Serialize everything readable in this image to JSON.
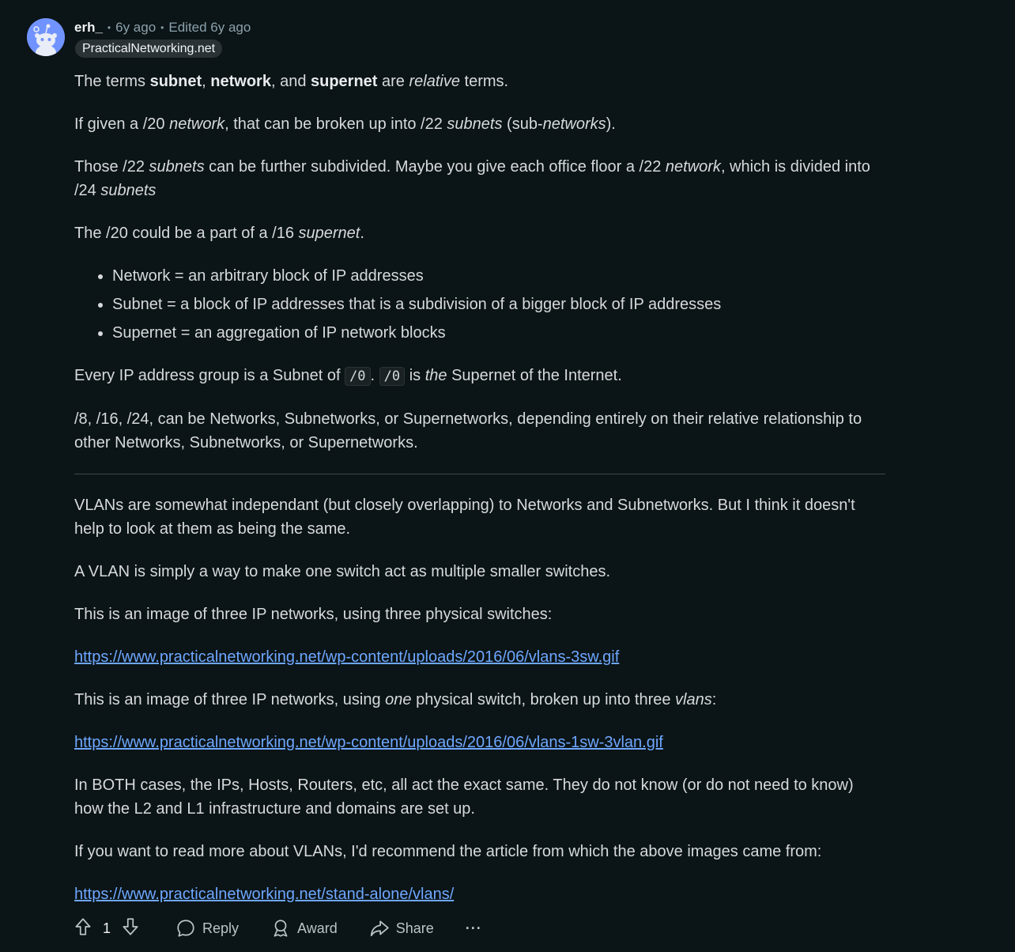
{
  "comment": {
    "author": "erh_",
    "age": "6y ago",
    "edited": "Edited 6y ago",
    "flair": "PracticalNetworking.net"
  },
  "body": {
    "p1": {
      "a": "The terms ",
      "b": "subnet",
      "c": ", ",
      "d": "network",
      "e": ", and ",
      "f": "supernet",
      "g": " are ",
      "h": "relative",
      "i": " terms."
    },
    "p2": {
      "a": "If given a /20 ",
      "b": "network",
      "c": ", that can be broken up into /22 ",
      "d": "subnets",
      "e": " (sub-",
      "f": "networks",
      "g": ")."
    },
    "p3": {
      "a": "Those /22 ",
      "b": "subnets",
      "c": " can be further subdivided. Maybe you give each office floor a /22 ",
      "d": "network",
      "e": ", which is divided into /24 ",
      "f": "subnets"
    },
    "p4": {
      "a": "The /20 could be a part of a /16 ",
      "b": "supernet",
      "c": "."
    },
    "bullets": [
      "Network = an arbitrary block of IP addresses",
      "Subnet = a block of IP addresses that is a subdivision of a bigger block of IP addresses",
      "Supernet = an aggregation of IP network blocks"
    ],
    "p5": {
      "a": "Every IP address group is a Subnet of ",
      "code1": "/0",
      "b": ". ",
      "code2": "/0",
      "c": " is ",
      "d": "the",
      "e": " Supernet of the Internet."
    },
    "p6": "/8, /16, /24, can be Networks, Subnetworks, or Supernetworks, depending entirely on their relative relationship to other Networks, Subnetworks, or Supernetworks.",
    "p7": "VLANs are somewhat independant (but closely overlapping) to Networks and Subnetworks. But I think it doesn't help to look at them as being the same.",
    "p8": "A VLAN is simply a way to make one switch act as multiple smaller switches.",
    "p9": "This is an image of three IP networks, using three physical switches:",
    "link1": "https://www.practicalnetworking.net/wp-content/uploads/2016/06/vlans-3sw.gif",
    "p10": {
      "a": "This is an image of three IP networks, using ",
      "b": "one",
      "c": " physical switch, broken up into three ",
      "d": "vlans",
      "e": ":"
    },
    "link2": "https://www.practicalnetworking.net/wp-content/uploads/2016/06/vlans-1sw-3vlan.gif",
    "p11": "In BOTH cases, the IPs, Hosts, Routers, etc, all act the exact same. They do not know (or do not need to know) how the L2 and L1 infrastructure and domains are set up.",
    "p12": "If you want to read more about VLANs, I'd recommend the article from which the above images came from:",
    "link3": "https://www.practicalnetworking.net/stand-alone/vlans/"
  },
  "actions": {
    "score": "1",
    "reply": "Reply",
    "award": "Award",
    "share": "Share",
    "more": "···"
  },
  "icons": {
    "avatar": "snoo-avatar-icon",
    "upvote": "arrow-up-icon",
    "downvote": "arrow-down-icon",
    "reply": "speech-bubble-icon",
    "award": "award-ribbon-icon",
    "share": "share-arrow-icon"
  },
  "colors": {
    "background": "#0b1416",
    "link": "#6ea7ff",
    "avatar": "#7193ff"
  }
}
